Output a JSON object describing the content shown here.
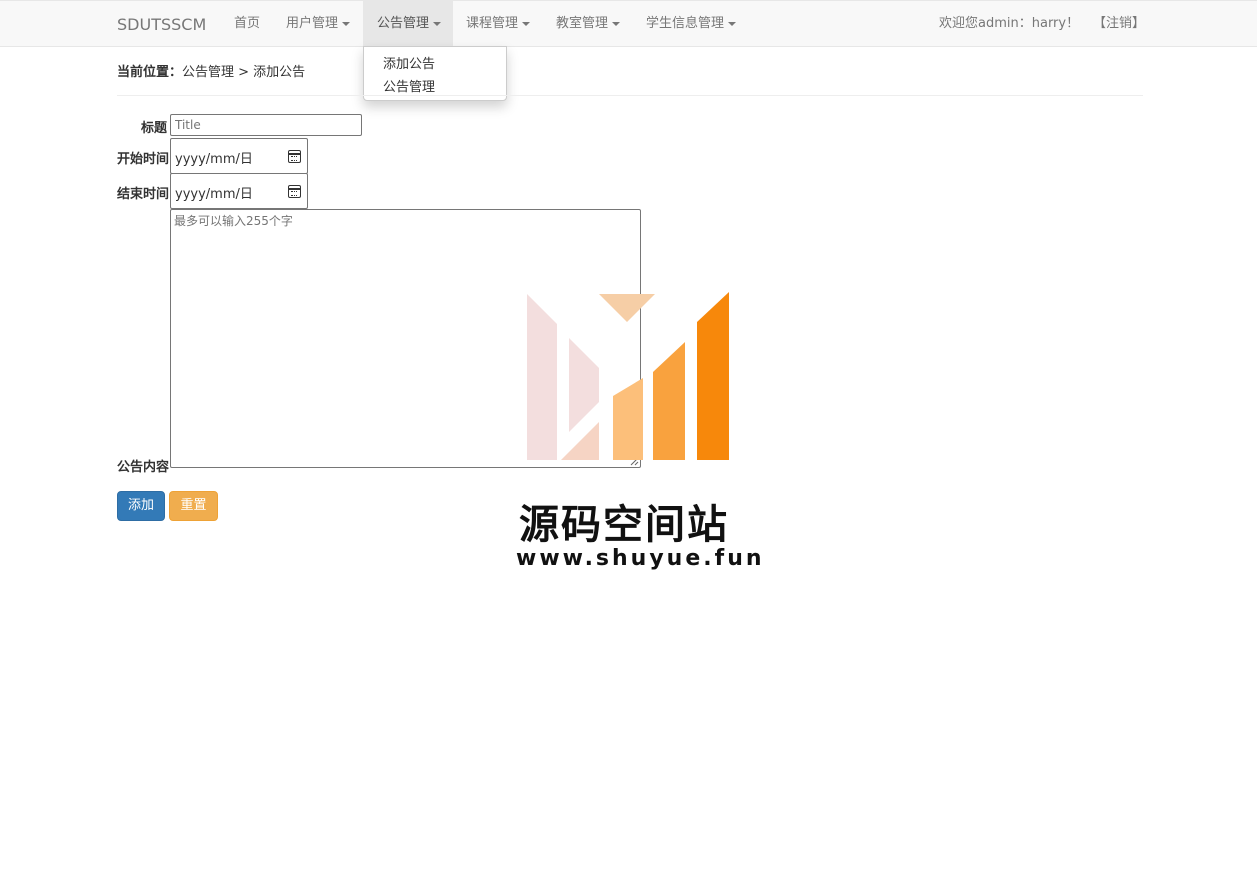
{
  "navbar": {
    "brand": "SDUTSSCM",
    "items": [
      {
        "label": "首页",
        "dropdown": false
      },
      {
        "label": "用户管理",
        "dropdown": true
      },
      {
        "label": "公告管理",
        "dropdown": true,
        "active": true
      },
      {
        "label": "课程管理",
        "dropdown": true
      },
      {
        "label": "教室管理",
        "dropdown": true
      },
      {
        "label": "学生信息管理",
        "dropdown": true
      }
    ],
    "welcome": "欢迎您admin：harry！",
    "logout": "【注销】"
  },
  "dropdown": {
    "items": [
      "添加公告",
      "公告管理"
    ]
  },
  "breadcrumb": {
    "prefix": "当前位置：",
    "path": "公告管理 > 添加公告"
  },
  "form": {
    "title_label": "标题",
    "title_placeholder": "Title",
    "start_label": "开始时间",
    "start_placeholder": "yyyy/mm/日",
    "end_label": "结束时间",
    "end_placeholder": "yyyy/mm/日",
    "content_label": "公告内容",
    "content_placeholder": "最多可以输入255个字",
    "submit_label": "添加",
    "reset_label": "重置"
  },
  "watermark": {
    "title": "源码空间站",
    "url": "www.shuyue.fun"
  },
  "colors": {
    "primary": "#337ab7",
    "warning": "#f0ad4e",
    "watermark_orange": "#f7880b"
  }
}
